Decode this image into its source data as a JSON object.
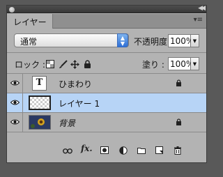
{
  "tab": {
    "label": "レイヤー"
  },
  "blend_mode": {
    "value": "通常"
  },
  "opacity": {
    "label": "不透明度 :",
    "value": "100%"
  },
  "lock": {
    "label": "ロック :"
  },
  "fill": {
    "label": "塗り :",
    "value": "100%"
  },
  "layers": [
    {
      "name": "ひまわり",
      "thumb_text": "T",
      "locked": true,
      "selected": false
    },
    {
      "name": "レイヤー 1",
      "locked": false,
      "selected": true
    },
    {
      "name": "背景",
      "locked": true,
      "selected": false
    }
  ],
  "colors": {
    "selection": "#b7d4f6",
    "panel": "#b3b3b3",
    "spinner": "#2e6fd6"
  }
}
